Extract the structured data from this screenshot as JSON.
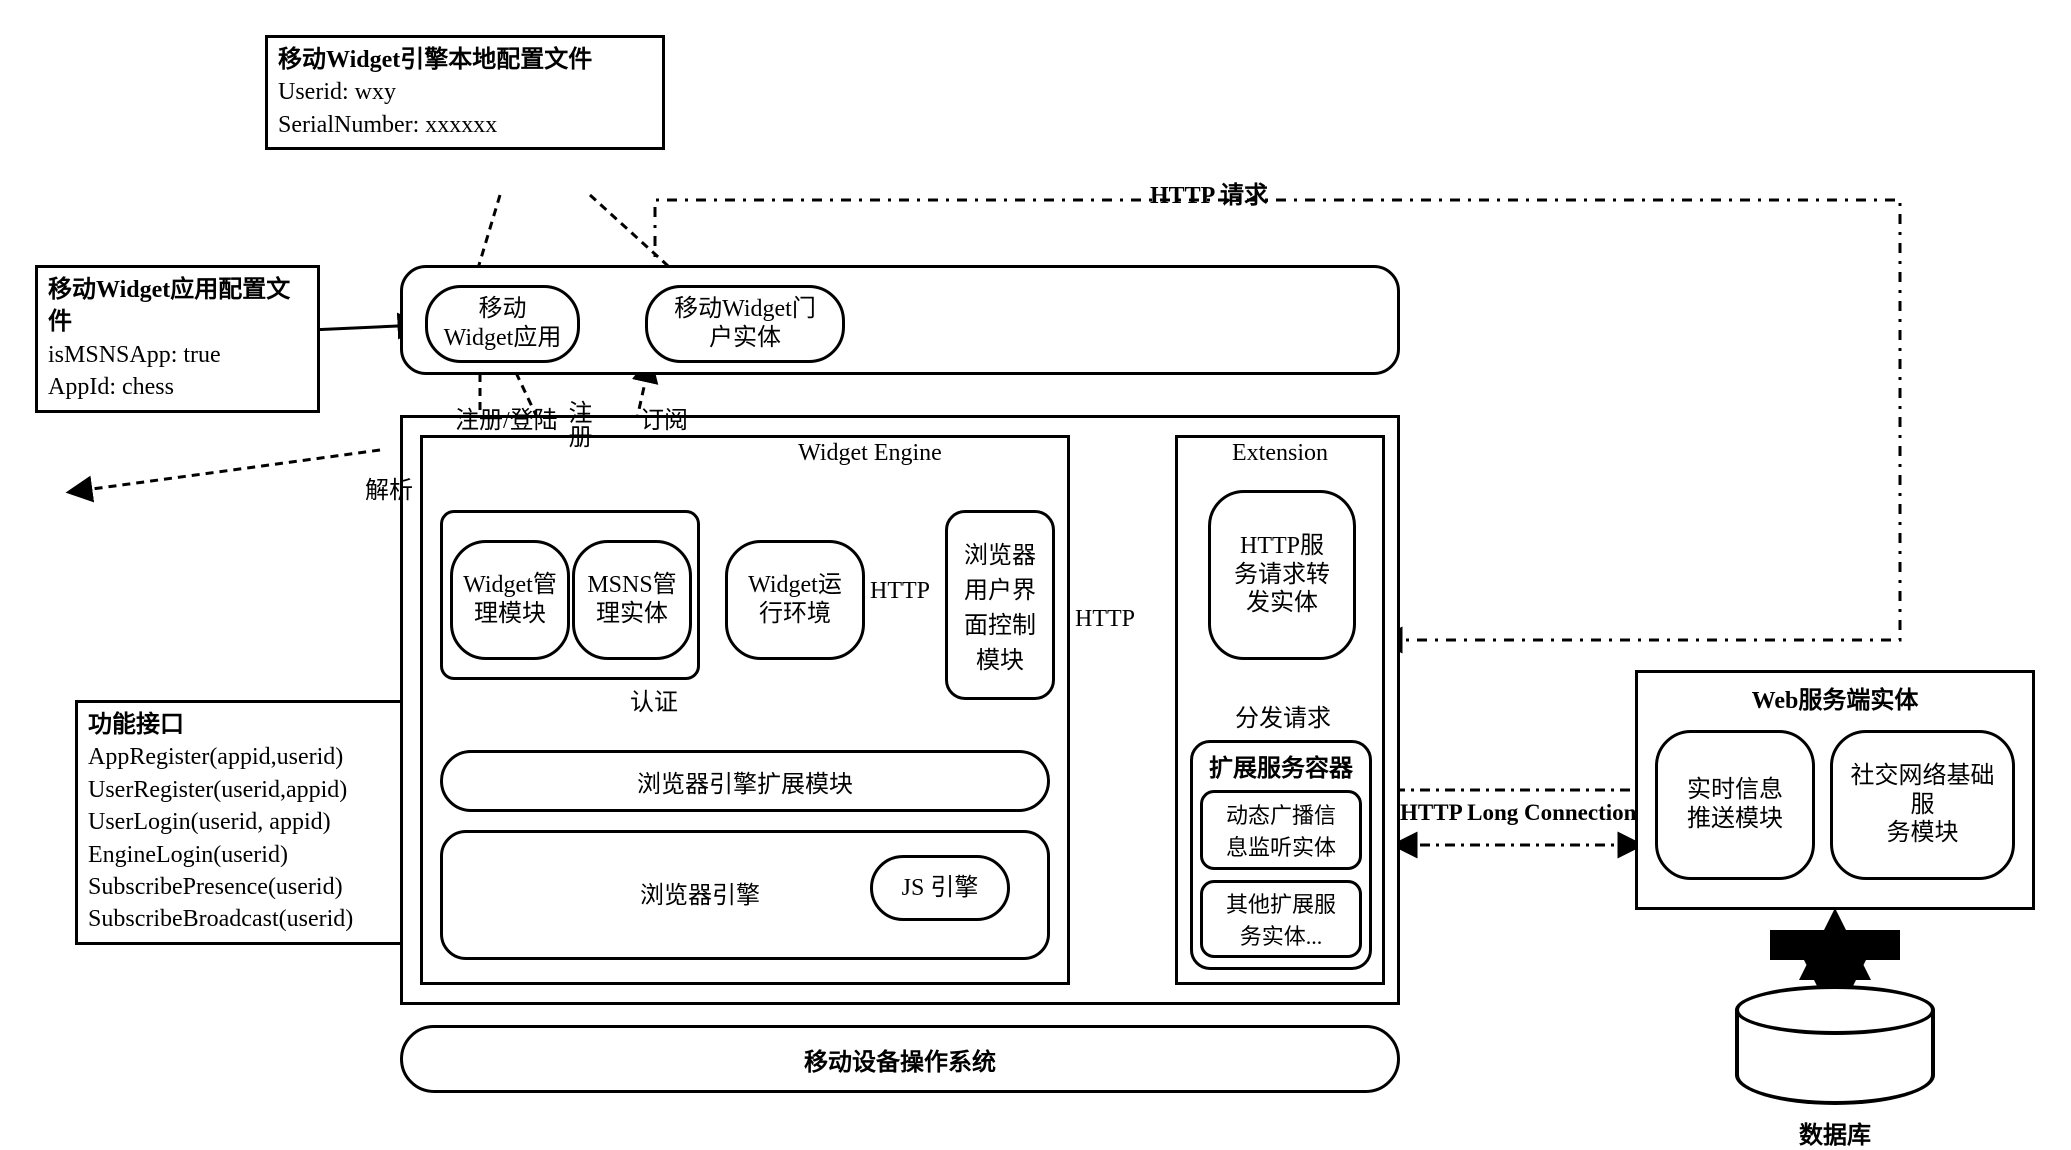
{
  "notes": {
    "engine_config": {
      "title": "移动Widget引擎本地配置文件",
      "line1": "Userid: wxy",
      "line2": "SerialNumber: xxxxxx"
    },
    "app_config": {
      "title": "移动Widget应用配置文件",
      "line1": "isMSNSApp: true",
      "line2": "AppId: chess"
    },
    "api": {
      "title": "功能接口",
      "l1": "AppRegister(appid,userid)",
      "l2": "UserRegister(userid,appid)",
      "l3": "UserLogin(userid, appid)",
      "l4": "EngineLogin(userid)",
      "l5": "SubscribePresence(userid)",
      "l6": "SubscribeBroadcast(userid)"
    }
  },
  "top_bar": {
    "app": "移动\nWidget应用",
    "portal": "移动Widget门\n户实体"
  },
  "engine": {
    "title": "Widget Engine",
    "widget_mgr": "Widget管\n理模块",
    "msns_mgr": "MSNS管\n理实体",
    "runtime": "Widget运\n行环境",
    "http1": "HTTP",
    "browser_ui": "浏览器\n用户界\n面控制\n模块",
    "http2": "HTTP",
    "auth": "认证",
    "ext_module": "浏览器引擎扩展模块",
    "browser_engine": "浏览器引擎",
    "js_engine": "JS 引擎"
  },
  "extension": {
    "title": "Extension",
    "http_fwd": "HTTP服\n务请求转\n发实体",
    "dispatch": "分发请求",
    "ext_container": "扩展服务容器",
    "broadcast": "动态广播信\n息监听实体",
    "other": "其他扩展服\n务实体..."
  },
  "os": "移动设备操作系统",
  "link_labels": {
    "register_login": "注册/登陆",
    "subscribe": "订阅",
    "parse": "解析",
    "register": "注册",
    "http_req": "HTTP 请求",
    "long_conn": "HTTP Long Connection"
  },
  "server": {
    "title": "Web服务端实体",
    "push": "实时信息\n推送模块",
    "social": "社交网络基础服\n务模块"
  },
  "db": "数据库"
}
